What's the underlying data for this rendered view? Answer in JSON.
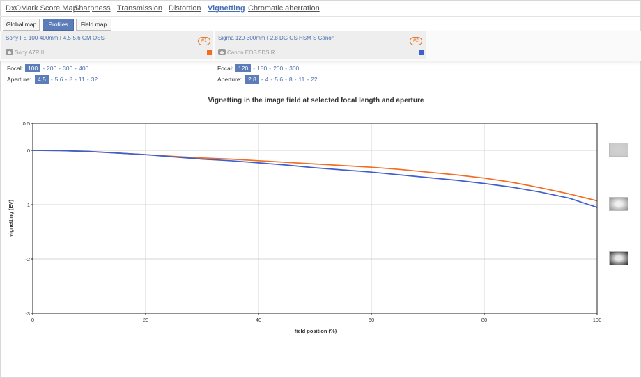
{
  "tabs": [
    {
      "label": "DxOMark Score Map",
      "active": false
    },
    {
      "label": "Sharpness",
      "active": false
    },
    {
      "label": "Transmission",
      "active": false
    },
    {
      "label": "Distortion",
      "active": false
    },
    {
      "label": "Vignetting",
      "active": true
    },
    {
      "label": "Chromatic aberration",
      "active": false
    }
  ],
  "subtabs": [
    {
      "label": "Global map",
      "active": false
    },
    {
      "label": "Profiles",
      "active": true
    },
    {
      "label": "Field map",
      "active": false
    }
  ],
  "lenses": [
    {
      "name": "Sony FE 100-400mm F4.5-5.6 GM OSS",
      "badge": "#1",
      "camera": "Sony A7R II",
      "color": "#f26c21",
      "focal_label": "Focal:",
      "focal_options": [
        "100",
        "200",
        "300",
        "400"
      ],
      "focal_selected": "100",
      "aperture_label": "Aperture:",
      "aperture_options": [
        "4.5",
        "5.6",
        "8",
        "11",
        "32"
      ],
      "aperture_selected": "4.5"
    },
    {
      "name": "Sigma 120-300mm F2.8 DG OS HSM S Canon",
      "badge": "#2",
      "camera": "Canon EOS 5DS R",
      "color": "#3f5fcc",
      "focal_label": "Focal:",
      "focal_options": [
        "120",
        "150",
        "200",
        "300"
      ],
      "focal_selected": "120",
      "aperture_label": "Aperture:",
      "aperture_options": [
        "2.8",
        "4",
        "5.6",
        "8",
        "11",
        "22"
      ],
      "aperture_selected": "2.8"
    }
  ],
  "chart_data": {
    "type": "line",
    "title": "Vignetting in the image field at selected focal length and aperture",
    "xlabel": "field position (%)",
    "ylabel": "vignetting (EV)",
    "xlim": [
      0,
      100
    ],
    "ylim": [
      -3,
      0.5
    ],
    "xticks": [
      0,
      20,
      40,
      60,
      80,
      100
    ],
    "yticks": [
      0.5,
      0,
      -1,
      -2,
      -3
    ],
    "ytick_labels": [
      "0.5",
      "0",
      "-1",
      "-2",
      "-3"
    ],
    "gridlines": [
      {
        "axis": "x",
        "value": 20
      },
      {
        "axis": "x",
        "value": 40
      },
      {
        "axis": "x",
        "value": 60
      },
      {
        "axis": "x",
        "value": 80
      },
      {
        "axis": "y",
        "value": 0
      },
      {
        "axis": "y",
        "value": -1
      },
      {
        "axis": "y",
        "value": -2
      }
    ],
    "grid": true,
    "legend": "none",
    "series": [
      {
        "color": "#f26c21",
        "x": [
          0,
          5,
          10,
          15,
          20,
          25,
          30,
          35,
          40,
          45,
          50,
          55,
          60,
          65,
          70,
          75,
          80,
          85,
          90,
          95,
          100
        ],
        "y": [
          0,
          -0.005,
          -0.02,
          -0.05,
          -0.08,
          -0.11,
          -0.14,
          -0.16,
          -0.19,
          -0.22,
          -0.25,
          -0.28,
          -0.31,
          -0.35,
          -0.4,
          -0.45,
          -0.51,
          -0.59,
          -0.69,
          -0.8,
          -0.93
        ]
      },
      {
        "color": "#3f5fcc",
        "x": [
          0,
          5,
          10,
          15,
          20,
          25,
          30,
          35,
          40,
          45,
          50,
          55,
          60,
          65,
          70,
          75,
          80,
          85,
          90,
          95,
          100
        ],
        "y": [
          0,
          -0.005,
          -0.02,
          -0.05,
          -0.08,
          -0.12,
          -0.16,
          -0.19,
          -0.23,
          -0.27,
          -0.32,
          -0.36,
          -0.4,
          -0.45,
          -0.5,
          -0.55,
          -0.61,
          -0.68,
          -0.77,
          -0.88,
          -1.05
        ]
      }
    ]
  },
  "field_thumbnails": [
    {
      "name": "uniform-field-thumbnail",
      "y_value": 0,
      "center": "#d0d0d0",
      "edge": "#c8c8c8"
    },
    {
      "name": "moderate-vignetting-thumbnail",
      "y_value": -1,
      "center": "#f0f0f0",
      "edge": "#8a8a8a"
    },
    {
      "name": "strong-vignetting-thumbnail",
      "y_value": -2,
      "center": "#e6e6e6",
      "edge": "#2a2a2a"
    }
  ]
}
